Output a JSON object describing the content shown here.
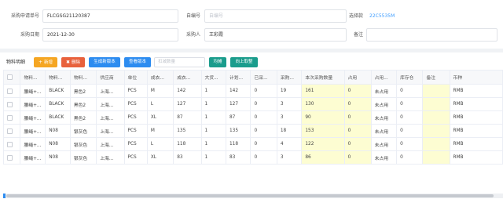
{
  "form": {
    "purchase_no_label": "采购申请单号",
    "purchase_no_value": "FLCGSG21120387",
    "custom_no_label": "自编号",
    "custom_no_placeholder": "自编号",
    "select_label": "选择款",
    "select_value": "22C5535M",
    "date_label": "采购日期",
    "date_value": "2021-12-30",
    "buyer_label": "采购人",
    "buyer_value": "王彩霞",
    "remark_label": "备注",
    "remark_value": ""
  },
  "toolbar": {
    "title": "物料明细",
    "add_label": "新增",
    "delete_label": "删除",
    "generate_label": "生成新版本",
    "view_version_label": "查看版本",
    "search_placeholder": "扣减数量",
    "apply_label": "均摊",
    "round_label": "向上取整"
  },
  "table": {
    "columns": [
      "物料...",
      "物料...",
      "物料...",
      "供应商",
      "单位",
      "成衣...",
      "成衣...",
      "大货...",
      "计划...",
      "已采...",
      "采购...",
      "本次采购数量",
      "占用",
      "占用...",
      "库存仓",
      "备注",
      "币种"
    ],
    "rows": [
      [
        "腰绳+...",
        "BLACK",
        "黑色2",
        "上海...",
        "PCS",
        "M",
        "142",
        "1",
        "142",
        "0",
        "19",
        "161",
        "0",
        "未占用",
        "0",
        "",
        "RMB"
      ],
      [
        "腰绳+...",
        "BLACK",
        "黑色2",
        "上海...",
        "PCS",
        "L",
        "127",
        "1",
        "127",
        "0",
        "3",
        "130",
        "0",
        "未占用",
        "0",
        "",
        "RMB"
      ],
      [
        "腰绳+...",
        "BLACK",
        "黑色2",
        "上海...",
        "PCS",
        "XL",
        "87",
        "1",
        "87",
        "0",
        "3",
        "90",
        "0",
        "未占用",
        "0",
        "",
        "RMB"
      ],
      [
        "腰绳+...",
        "N08",
        "银灰色",
        "上海...",
        "PCS",
        "M",
        "135",
        "1",
        "135",
        "0",
        "18",
        "153",
        "0",
        "未占用",
        "0",
        "",
        "RMB"
      ],
      [
        "腰绳+...",
        "N08",
        "银灰色",
        "上海...",
        "PCS",
        "L",
        "118",
        "1",
        "118",
        "0",
        "4",
        "122",
        "0",
        "未占用",
        "0",
        "",
        "RMB"
      ],
      [
        "腰绳+...",
        "N08",
        "银灰色",
        "上海...",
        "PCS",
        "XL",
        "83",
        "1",
        "83",
        "0",
        "3",
        "86",
        "0",
        "未占用",
        "0",
        "",
        "RMB"
      ]
    ]
  },
  "icons": {
    "add": "plus-icon",
    "delete": "trash-icon"
  },
  "colors": {
    "accent": "#409eff",
    "highlight_cell": "#fdfdd2",
    "btn_add": "#f5a623",
    "btn_delete": "#e8613c",
    "btn_primary": "#2d8cf0",
    "btn_teal": "#1a9c8c"
  }
}
